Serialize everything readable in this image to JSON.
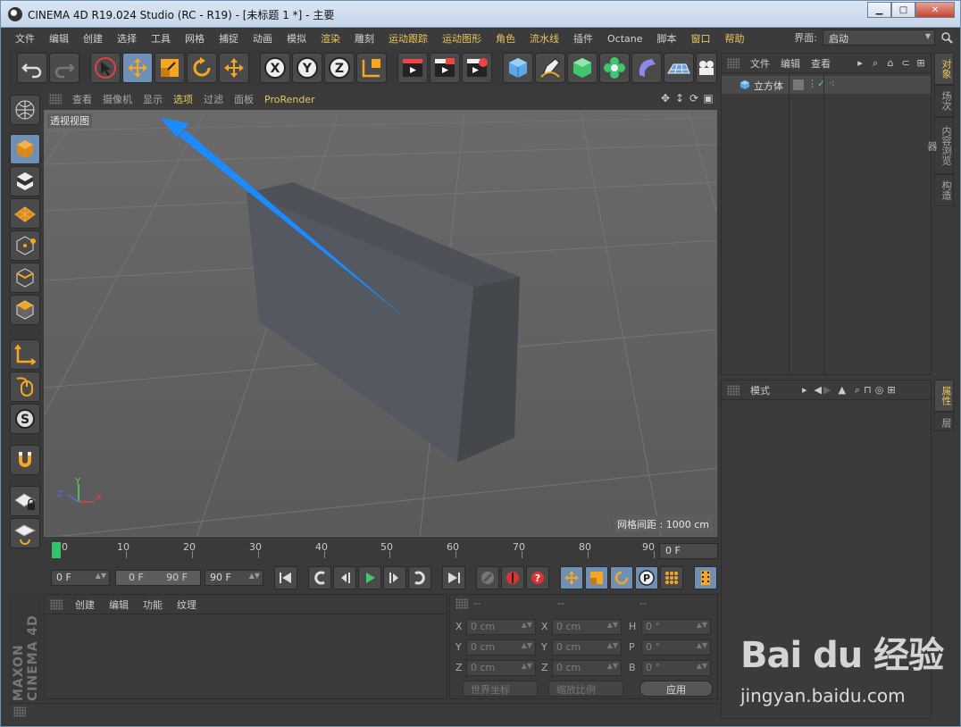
{
  "window": {
    "title": "CINEMA 4D R19.024 Studio (RC - R19) - [未标题 1 *] - 主要",
    "minimize": "▁",
    "maximize": "□",
    "close": "✕"
  },
  "menubar": {
    "items": [
      "文件",
      "编辑",
      "创建",
      "选择",
      "工具",
      "网格",
      "捕捉",
      "动画",
      "模拟",
      "渲染",
      "雕刻",
      "运动跟踪",
      "运动图形",
      "角色",
      "流水线",
      "插件",
      "Octane",
      "脚本",
      "窗口",
      "帮助"
    ],
    "layout_label": "界面:",
    "layout_value": "启动"
  },
  "viewport": {
    "menu": [
      "查看",
      "摄像机",
      "显示",
      "选项",
      "过滤",
      "面板",
      "ProRender"
    ],
    "view_name": "透视视图",
    "grid_spacing": "网格间距 : 1000 cm",
    "axis_x": "X",
    "axis_y": "Y",
    "axis_z": "Z"
  },
  "timeline": {
    "ticks": [
      "0",
      "10",
      "20",
      "30",
      "40",
      "50",
      "60",
      "70",
      "80",
      "90"
    ],
    "current_frame": "0 F"
  },
  "transport": {
    "start": "0 F",
    "range_start": "0 F",
    "range_end": "90 F",
    "end": "90 F"
  },
  "material_panel": {
    "menu": [
      "创建",
      "编辑",
      "功能",
      "纹理"
    ]
  },
  "coord_panel": {
    "headers": [
      "--",
      "--",
      "--"
    ],
    "rows": [
      {
        "a": "X",
        "av": "0 cm",
        "b": "X",
        "bv": "0 cm",
        "c": "H",
        "cv": "0 °"
      },
      {
        "a": "Y",
        "av": "0 cm",
        "b": "Y",
        "bv": "0 cm",
        "c": "P",
        "cv": "0 °"
      },
      {
        "a": "Z",
        "av": "0 cm",
        "b": "Z",
        "bv": "0 cm",
        "c": "B",
        "cv": "0 °"
      }
    ],
    "world_coord": "世界坐标",
    "scale": "缩放比例",
    "apply": "应用"
  },
  "object_panel": {
    "menu": [
      "文件",
      "编辑",
      "查看"
    ],
    "object_name": "立方体"
  },
  "attr_panel": {
    "menu": [
      "模式"
    ]
  },
  "side_tabs_top": [
    "对象",
    "场次",
    "内容浏览器",
    "构造"
  ],
  "side_tabs_bottom": [
    "属性",
    "层"
  ],
  "brand": "MAXON CINEMA 4D",
  "watermark": {
    "logo": "Bai du 经验",
    "url": "jingyan.baidu.com"
  },
  "colors": {
    "accent_yellow": "#e8c65c",
    "active_blue": "#6f8fb5",
    "arrow_blue": "#1a8cff"
  }
}
